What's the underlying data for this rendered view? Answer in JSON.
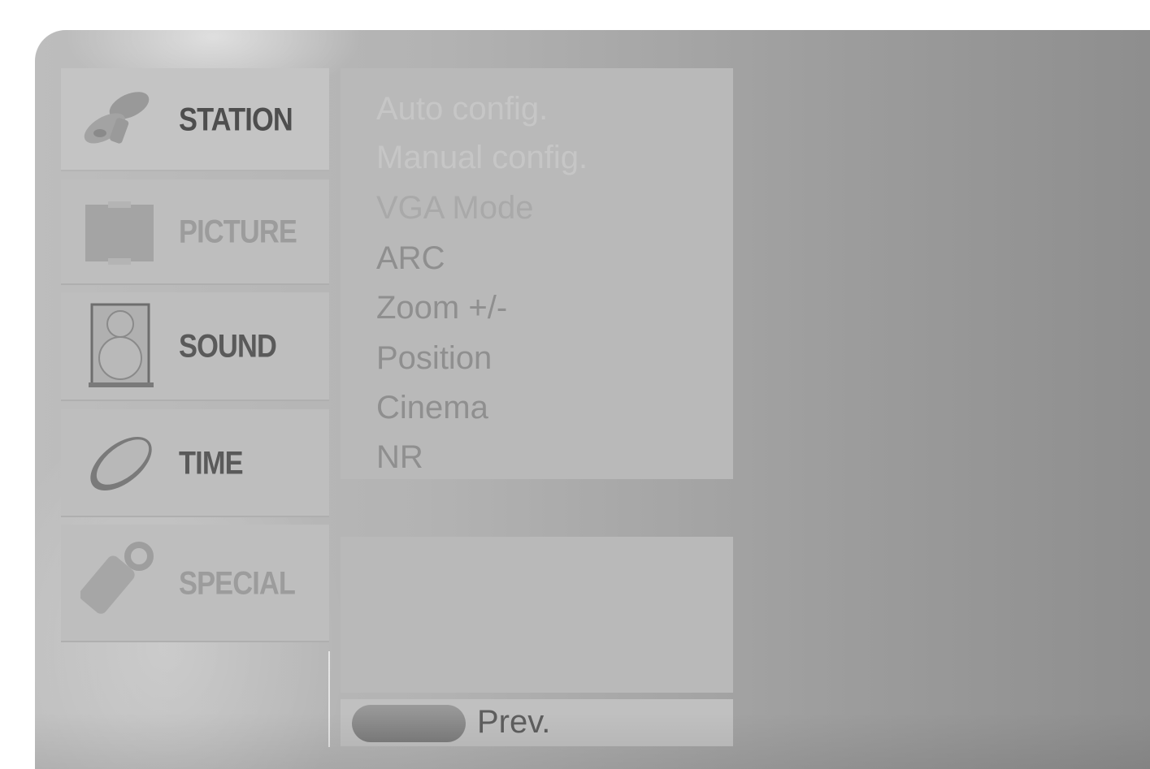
{
  "menu": {
    "sidebar": [
      {
        "label": "STATION",
        "icon": "satellite-icon",
        "active": true
      },
      {
        "label": "PICTURE",
        "icon": "picture-icon",
        "active": false
      },
      {
        "label": "SOUND",
        "icon": "speaker-icon",
        "active": false
      },
      {
        "label": "TIME",
        "icon": "clock-icon",
        "active": false
      },
      {
        "label": "SPECIAL",
        "icon": "key-tag-icon",
        "active": false
      }
    ],
    "submenu": [
      "Auto config.",
      "Manual config.",
      "VGA Mode",
      "ARC",
      "Zoom +/-",
      "Position",
      "Cinema",
      "NR"
    ],
    "footer": {
      "prev_label": "Prev."
    }
  }
}
